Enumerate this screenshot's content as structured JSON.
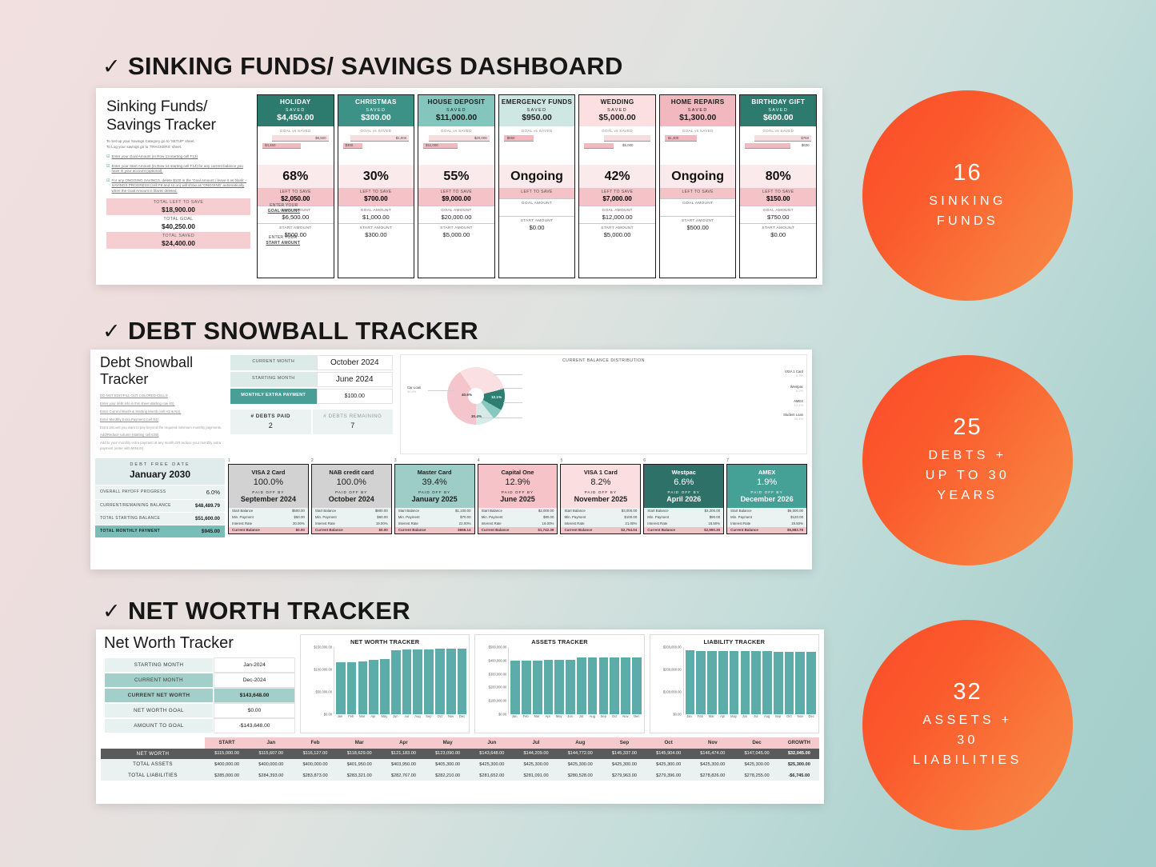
{
  "sections": [
    {
      "check": "✓",
      "title": "SINKING FUNDS/ SAVINGS DASHBOARD"
    },
    {
      "check": "✓",
      "title": "DEBT SNOWBALL TRACKER"
    },
    {
      "check": "✓",
      "title": "NET WORTH TRACKER"
    }
  ],
  "sinking": {
    "heading": "Sinking Funds/ Savings Tracker",
    "desc_line1": "To Set up your Savings Category go to 'SETUP' sheet.",
    "desc_line2": "To Log your savings go to 'TRACKERS' sheet.",
    "note1": "Enter your Goal Amount (in Row 13 starting cell F13)",
    "note2": "Enter your Start Amount (in Row 14 starting cell F14) for any current balance you have in your account (optional).",
    "note3": "For any ONGOING SAVINGS, delete $100 in the 'Goal Amount / leave it as blank' - SAVINGS PROGRESS (cell F8 and so on) will show as 'ONGOING' automatically when the Goal Amount is blank/ deleted.",
    "totals": [
      {
        "label": "TOTAL LEFT TO SAVE",
        "value": "$18,900.00",
        "style": "pink"
      },
      {
        "label": "TOTAL GOAL",
        "value": "$40,250.00",
        "style": "white"
      },
      {
        "label": "TOTAL SAVED",
        "value": "$24,400.00",
        "style": "pink"
      }
    ],
    "hint1_a": "ENTER YOUR",
    "hint1_b": "GOAL AMOUNT",
    "hint2_a": "ENTER YOUR",
    "hint2_b": "START AMOUNT",
    "labels": {
      "saved": "SAVED",
      "goal_vs_saved": "GOAL vs SAVED",
      "left_to_save": "LEFT TO SAVE",
      "goal_amount": "GOAL AMOUNT",
      "start_amount": "START AMOUNT"
    },
    "cards": [
      {
        "name": "HOLIDAY",
        "saved": "$4,450.00",
        "head_bg": "#2d7a6e",
        "head_fg": "#ffffff",
        "goal_bar": "$6,500",
        "goal_w": 85,
        "save_bar": "$4,450",
        "save_w": 58,
        "pct": "68%",
        "left": "$2,050.00",
        "goal_amount": "$6,500.00",
        "start_amount": "$500.00"
      },
      {
        "name": "CHRISTMAS",
        "saved": "$300.00",
        "head_bg": "#3d9288",
        "head_fg": "#ffffff",
        "goal_bar": "$1,000",
        "goal_w": 88,
        "save_bar": "$300",
        "save_w": 30,
        "pct": "30%",
        "left": "$700.00",
        "goal_amount": "$1,000.00",
        "start_amount": "$300.00"
      },
      {
        "name": "HOUSE DEPOSIT",
        "saved": "$11,000.00",
        "head_bg": "#84c5bd",
        "head_fg": "#1d1d1d",
        "goal_bar": "$20,000",
        "goal_w": 92,
        "save_bar": "$11,000",
        "save_w": 52,
        "pct": "55%",
        "left": "$9,000.00",
        "goal_amount": "$20,000.00",
        "start_amount": "$5,000.00"
      },
      {
        "name": "EMERGENCY FUNDS",
        "saved": "$950.00",
        "head_bg": "#cfe7e3",
        "head_fg": "#1d1d1d",
        "goal_bar": "",
        "goal_w": 0,
        "save_bar": "$950",
        "save_w": 45,
        "pct": "Ongoing",
        "left": "",
        "goal_amount": "",
        "start_amount": "$0.00"
      },
      {
        "name": "WEDDING",
        "saved": "$5,000.00",
        "head_bg": "#fbdfe1",
        "head_fg": "#1d1d1d",
        "goal_bar": "",
        "goal_w": 70,
        "save_bar": "$5,000",
        "save_w": 45,
        "pct": "42%",
        "left": "$7,000.00",
        "goal_amount": "$12,000.00",
        "start_amount": "$5,000.00"
      },
      {
        "name": "HOME REPAIRS",
        "saved": "$1,300.00",
        "head_bg": "#f1b9bf",
        "head_fg": "#1d1d1d",
        "goal_bar": "",
        "goal_w": 0,
        "save_bar": "$1,300",
        "save_w": 48,
        "pct": "Ongoing",
        "left": "",
        "goal_amount": "",
        "start_amount": "$500.00"
      },
      {
        "name": "BIRTHDAY GIFT",
        "saved": "$600.00",
        "head_bg": "#2d7a6e",
        "head_fg": "#ffffff",
        "goal_bar": "$750",
        "goal_w": 86,
        "save_bar": "$600",
        "save_w": 68,
        "pct": "80%",
        "left": "$150.00",
        "goal_amount": "$750.00",
        "start_amount": "$0.00"
      }
    ]
  },
  "debt": {
    "heading": "Debt Snowball Tracker",
    "instructions": [
      "DO NOT EDIT/FILL OUT COLORED CELLS",
      "Enter your debt info in this sheet starting row 40).",
      "Enter Current Month & Starting Month (cell H2 & N3).",
      "Enter Monthly Extra Payment (cell N4)",
      "Extra amount you want to pay beyond the required minimum monthly payments.",
      "Add/Reduce column (starting cell E26)",
      "Add to your monthly extra payment at any month OR reduce your monthly extra payment (enter with MINUS)."
    ],
    "summary": [
      {
        "k": "CURRENT MONTH",
        "v": "October 2024",
        "style": "plain"
      },
      {
        "k": "STARTING MONTH",
        "v": "June 2024",
        "style": "plain"
      },
      {
        "k": "MONTHLY EXTRA PAYMENT",
        "v": "$100.00",
        "style": "teal"
      }
    ],
    "counters": [
      {
        "t": "# DEBTS  PAID",
        "n": "2",
        "gray": false
      },
      {
        "t": "# DEBTS REMAINING",
        "n": "7",
        "gray": true
      }
    ],
    "debt_free_label": "DEBT FREE DATE",
    "debt_free_date": "January 2030",
    "stats": [
      {
        "l": "OVERALL PAYOFF PROGRESS",
        "v": "6.0%",
        "big": true
      },
      {
        "l": "CURRENT/REMAINING BALANCE",
        "v": "$48,489.79",
        "big": false
      },
      {
        "l": "TOTAL STARTING BALANCE",
        "v": "$51,600.00",
        "big": false
      },
      {
        "l": "TOTAL MONTHLY PAYMENT",
        "v": "$945.00",
        "big": false,
        "teal": true
      }
    ],
    "row_labels": {
      "start": "Start Balance",
      "min": "Min. Payment",
      "rate": "Interest Rate",
      "current": "Current Balance",
      "paid_off_by": "PAID OFF BY"
    },
    "cards": [
      {
        "no": "1",
        "name": "VISA 2 Card",
        "pct": "100.0%",
        "date": "September 2024",
        "start": "$500.00",
        "min": "$50.00",
        "rate": "20.00%",
        "current": "$0.00",
        "bg": "#d2d2d2",
        "fg": "#1d1d1d"
      },
      {
        "no": "2",
        "name": "NAB credit card",
        "pct": "100.0%",
        "date": "October 2024",
        "start": "$800.00",
        "min": "$60.00",
        "rate": "19.00%",
        "current": "$0.00",
        "bg": "#d2d2d2",
        "fg": "#1d1d1d"
      },
      {
        "no": "3",
        "name": "Master Card",
        "pct": "39.4%",
        "date": "January 2025",
        "start": "$1,100.00",
        "min": "$70.00",
        "rate": "22.00%",
        "current": "$666.14",
        "bg": "#9ecdc7",
        "fg": "#1d1d1d"
      },
      {
        "no": "4",
        "name": "Capital One",
        "pct": "12.9%",
        "date": "June 2025",
        "start": "$2,000.00",
        "min": "$80.00",
        "rate": "18.00%",
        "current": "$1,742.39",
        "bg": "#f6c4c8",
        "fg": "#1d1d1d"
      },
      {
        "no": "5",
        "name": "VISA 1 Card",
        "pct": "8.2%",
        "date": "November 2025",
        "start": "$3,000.00",
        "min": "$100.00",
        "rate": "21.00%",
        "current": "$2,754.04",
        "bg": "#fbdee0",
        "fg": "#1d1d1d"
      },
      {
        "no": "6",
        "name": "Westpac",
        "pct": "6.6%",
        "date": "April 2026",
        "start": "$3,200.00",
        "min": "$90.00",
        "rate": "18.50%",
        "current": "$2,990.30",
        "bg": "#2d7168",
        "fg": "#ffffff"
      },
      {
        "no": "7",
        "name": "AMEX",
        "pct": "1.9%",
        "date": "December 2026",
        "start": "$6,000.00",
        "min": "$120.00",
        "rate": "19.50%",
        "current": "$5,883.78",
        "bg": "#45a096",
        "fg": "#ffffff"
      }
    ],
    "chart_data": {
      "type": "pie",
      "title": "CURRENT BALANCE DISTRIBUTION",
      "categories": [
        "Car Loan",
        "Student Loan",
        "AMEX",
        "Westpac",
        "VISA 1 Card"
      ],
      "values": [
        40.6,
        30.4,
        12.1,
        6.2,
        5.7
      ],
      "labels": [
        "40.6%",
        "30.4%",
        "12.1%",
        "6.2%",
        "5.7%"
      ],
      "colors": [
        "#f4c6cb",
        "#fae0e2",
        "#2e7d72",
        "#86c7c0",
        "#d6ebe8"
      ],
      "legend": "callout"
    }
  },
  "networth": {
    "heading": "Net Worth Tracker",
    "fields": [
      {
        "k": "STARTING MONTH",
        "v": "Jan-2024",
        "hl": "lite"
      },
      {
        "k": "CURRENT MONTH",
        "v": "Dec-2024",
        "hl": "mid"
      },
      {
        "k": "CURRENT NET WORTH",
        "v": "$143,648.00",
        "hl": "strong"
      },
      {
        "k": "NET WORTH GOAL",
        "v": "$0.00",
        "hl": "lite"
      },
      {
        "k": "AMOUNT TO GOAL",
        "v": "-$143,648.00",
        "hl": "lite"
      }
    ],
    "table": {
      "columns": [
        "",
        "START",
        "Jan",
        "Feb",
        "Mar",
        "Apr",
        "May",
        "Jun",
        "Jul",
        "Aug",
        "Sep",
        "Oct",
        "Nov",
        "Dec",
        "GROWTH"
      ],
      "rows": [
        {
          "label": "NET WORTH",
          "cls": "nw",
          "cells": [
            "$115,000.00",
            "$115,607.00",
            "$116,127.00",
            "$118,629.00",
            "$121,183.00",
            "$123,090.00",
            "$143,648.00",
            "$144,209.00",
            "$144,772.00",
            "$145,337.00",
            "$145,904.00",
            "$146,474.00",
            "$147,045.00",
            "$32,045.00"
          ]
        },
        {
          "label": "TOTAL ASSETS",
          "cls": "ta",
          "cells": [
            "$400,000.00",
            "$400,000.00",
            "$400,000.00",
            "$401,950.00",
            "$403,950.00",
            "$405,300.00",
            "$425,300.00",
            "$425,300.00",
            "$425,300.00",
            "$425,300.00",
            "$425,300.00",
            "$425,300.00",
            "$425,300.00",
            "$25,300.00"
          ]
        },
        {
          "label": "TOTAL LIABILITIES",
          "cls": "tl",
          "cells": [
            "$285,000.00",
            "$284,393.00",
            "$283,873.00",
            "$283,321.00",
            "$282,767.00",
            "$282,210.00",
            "$281,652.00",
            "$281,091.00",
            "$280,528.00",
            "$279,963.00",
            "$279,396.00",
            "$278,826.00",
            "$278,255.00",
            "-$6,745.00"
          ]
        }
      ]
    },
    "chart_data": [
      {
        "type": "bar",
        "title": "NET WORTH TRACKER",
        "categories": [
          "Jan",
          "Feb",
          "Mar",
          "Apr",
          "May",
          "Jun",
          "Jul",
          "Aug",
          "Sep",
          "Oct",
          "Nov",
          "Dec"
        ],
        "values": [
          115607,
          116127,
          118629,
          121183,
          123090,
          143648,
          144209,
          144772,
          145337,
          145904,
          146474,
          147045
        ],
        "ylim": [
          0,
          150000
        ],
        "yticks": [
          "$0.00",
          "$50,000.00",
          "$100,000.00",
          "$150,000.00"
        ],
        "color": "#5cada9",
        "xlabel": "",
        "ylabel": ""
      },
      {
        "type": "bar",
        "title": "ASSETS TRACKER",
        "categories": [
          "Jan",
          "Feb",
          "Mar",
          "Apr",
          "May",
          "Jun",
          "Jul",
          "Aug",
          "Sep",
          "Oct",
          "Nov",
          "Dec"
        ],
        "values": [
          400000,
          400000,
          400000,
          401950,
          403950,
          405300,
          425300,
          425300,
          425300,
          425300,
          425300,
          425300
        ],
        "ylim": [
          0,
          500000
        ],
        "yticks": [
          "$0.00",
          "$100,000.00",
          "$200,000.00",
          "$300,000.00",
          "$400,000.00",
          "$500,000.00"
        ],
        "color": "#5cada9",
        "xlabel": "",
        "ylabel": ""
      },
      {
        "type": "bar",
        "title": "LIABILITY TRACKER",
        "categories": [
          "Jan",
          "Feb",
          "Mar",
          "Apr",
          "May",
          "Jun",
          "Jul",
          "Aug",
          "Sep",
          "Oct",
          "Nov",
          "Dec"
        ],
        "values": [
          284393,
          283873,
          283321,
          282767,
          282210,
          281652,
          281091,
          280528,
          279963,
          279396,
          278826,
          278255
        ],
        "ylim": [
          0,
          300000
        ],
        "yticks": [
          "$0.00",
          "$100,000.00",
          "$200,000.00",
          "$300,000.00"
        ],
        "color": "#5cada9",
        "xlabel": "",
        "ylabel": ""
      }
    ]
  },
  "badges": [
    {
      "num": "16",
      "txt": "SINKING\nFUNDS"
    },
    {
      "num": "25",
      "txt": "DEBTS +\nUP TO 30\nYEARS"
    },
    {
      "num": "32",
      "txt": "ASSETS +\n30\nLIABILITIES"
    }
  ]
}
